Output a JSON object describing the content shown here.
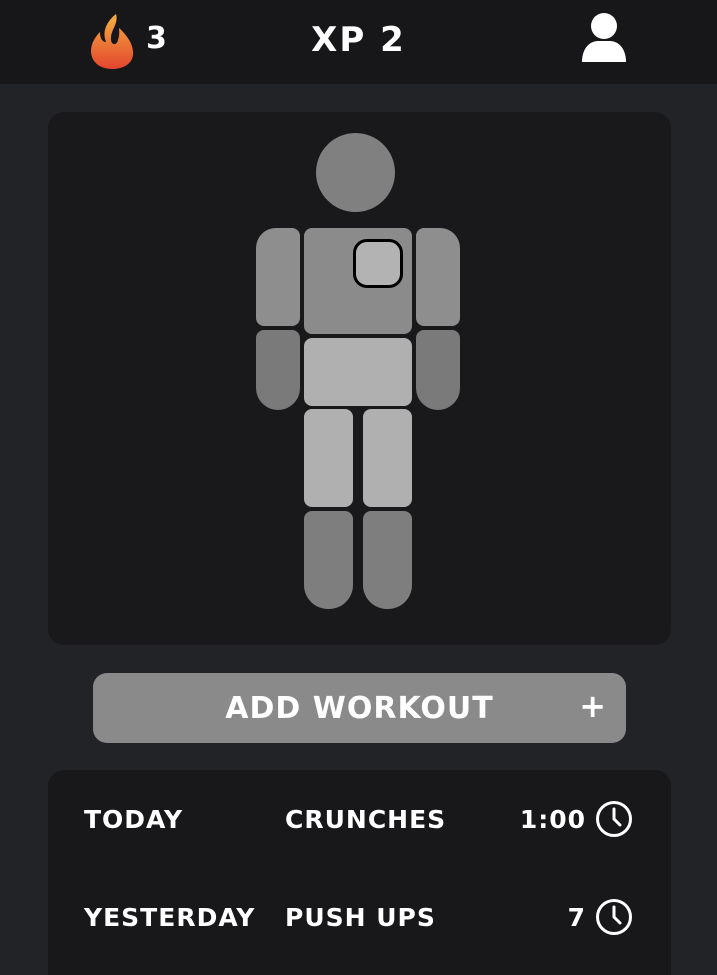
{
  "header": {
    "streak_icon": "flame-icon",
    "streak_count": "3",
    "xp_label": "XP 2",
    "profile_icon": "user-icon"
  },
  "body_map": {
    "parts": [
      "head",
      "chest",
      "upper-arm-left",
      "upper-arm-right",
      "forearm-left",
      "forearm-right",
      "abs",
      "thigh-left",
      "thigh-right",
      "calf-left",
      "calf-right"
    ],
    "selected_part": "chest"
  },
  "add_workout": {
    "label": "ADD WORKOUT",
    "plus": "+"
  },
  "log": [
    {
      "day": "TODAY",
      "exercise": "CRUNCHES",
      "value": "1:00",
      "icon": "clock-icon"
    },
    {
      "day": "YESTERDAY",
      "exercise": "PUSH UPS",
      "value": "7",
      "icon": "clock-icon"
    }
  ],
  "colors": {
    "background": "#222326",
    "topbar": "#17171a",
    "card": "#19191c",
    "button": "#8a8a8a",
    "flame_top": "#f4a23b",
    "flame_bottom": "#e0452f"
  }
}
